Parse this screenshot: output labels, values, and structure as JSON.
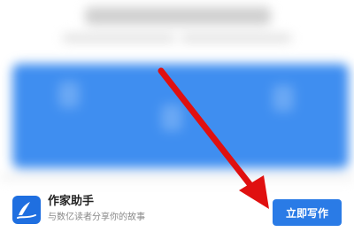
{
  "app": {
    "name": "作家助手",
    "description": "与数亿读者分享你的故事",
    "write_button_label": "立即写作"
  },
  "colors": {
    "primary_blue": "#2a7be6",
    "banner_blue": "#3f8ef0",
    "annotation_red": "#e01010"
  },
  "icons": {
    "app_logo": "pen-writing-icon",
    "annotation": "red-arrow"
  }
}
